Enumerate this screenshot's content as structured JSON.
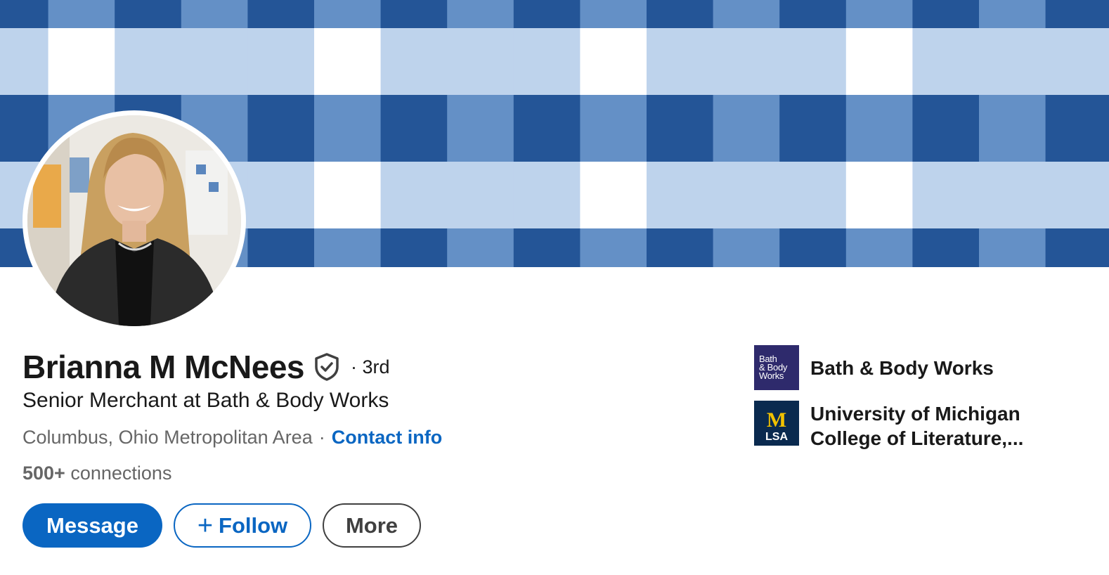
{
  "profile": {
    "name": "Brianna M McNees",
    "degree": "· 3rd",
    "headline": "Senior Merchant at Bath & Body Works",
    "location": "Columbus, Ohio Metropolitan Area",
    "location_separator": "·",
    "contact_info_label": "Contact info",
    "connections_count": "500+",
    "connections_label": "connections"
  },
  "actions": {
    "message_label": "Message",
    "follow_plus": "+",
    "follow_label": "Follow",
    "more_label": "More"
  },
  "organizations": [
    {
      "name": "Bath & Body Works",
      "logo_lines": [
        "Bath",
        "& Body",
        "Works"
      ],
      "logo_icon": "bath-body-works-logo",
      "logo_color": "#2e2a6c"
    },
    {
      "name_line1": "University of Michigan",
      "name_line2": "College of Literature,...",
      "logo_letter": "M",
      "logo_text": "LSA",
      "logo_icon": "umich-lsa-logo",
      "logo_color": "#0a2a4f",
      "logo_accent": "#f2c200"
    }
  ],
  "colors": {
    "accent": "#0a66c2",
    "cover_dark": "#245597",
    "cover_mid": "#6490c6",
    "cover_light": "#bed3ec",
    "cover_white": "#ffffff"
  },
  "icons": {
    "verified": "verified-shield-icon"
  }
}
